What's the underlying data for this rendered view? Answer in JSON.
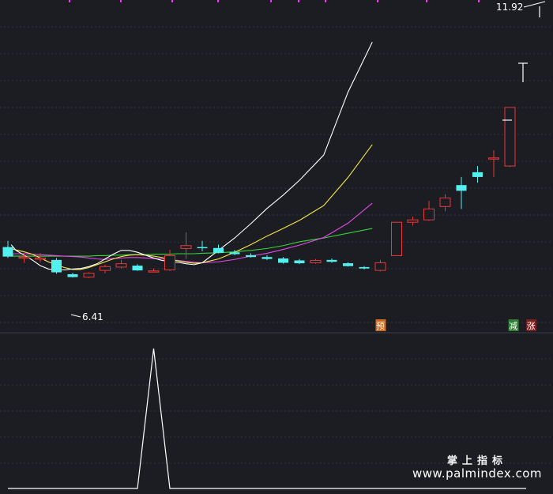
{
  "colors": {
    "background": "#1c1d22",
    "grid": "#2f3440",
    "up": "#e8383a",
    "down": "#54f0f0",
    "ma5": "#ffffff",
    "ma10": "#f5e84a",
    "ma20": "#e24be6",
    "ma60": "#38d23b",
    "indicator": "#ffffff",
    "signal_pre_bg": "#d2691e",
    "signal_reduce_bg": "#2e7d32",
    "signal_rise_bg": "#7a1f1f"
  },
  "chart_data": [
    {
      "type": "candlestick",
      "price_range": [
        5.6,
        12.2
      ],
      "high_label": "11.92",
      "low_label": "6.41",
      "candles": [
        {
          "o": 7.05,
          "h": 7.18,
          "l": 6.82,
          "c": 6.85
        },
        {
          "o": 6.83,
          "h": 6.9,
          "l": 6.72,
          "c": 6.84
        },
        {
          "o": 6.81,
          "h": 6.92,
          "l": 6.73,
          "c": 6.82
        },
        {
          "o": 6.78,
          "h": 6.82,
          "l": 6.49,
          "c": 6.52
        },
        {
          "o": 6.48,
          "h": 6.51,
          "l": 6.41,
          "c": 6.42
        },
        {
          "o": 6.42,
          "h": 6.52,
          "l": 6.4,
          "c": 6.5
        },
        {
          "o": 6.56,
          "h": 6.68,
          "l": 6.5,
          "c": 6.64
        },
        {
          "o": 6.63,
          "h": 6.78,
          "l": 6.6,
          "c": 6.7
        },
        {
          "o": 6.66,
          "h": 6.69,
          "l": 6.55,
          "c": 6.56
        },
        {
          "o": 6.55,
          "h": 6.6,
          "l": 6.52,
          "c": 6.55
        },
        {
          "o": 6.57,
          "h": 6.99,
          "l": 6.55,
          "c": 6.87
        },
        {
          "o": 7.02,
          "h": 7.36,
          "l": 6.8,
          "c": 7.08
        },
        {
          "o": 7.05,
          "h": 7.18,
          "l": 6.96,
          "c": 7.04
        },
        {
          "o": 7.03,
          "h": 7.1,
          "l": 6.92,
          "c": 6.93
        },
        {
          "o": 6.94,
          "h": 6.99,
          "l": 6.88,
          "c": 6.9
        },
        {
          "o": 6.88,
          "h": 6.92,
          "l": 6.83,
          "c": 6.84
        },
        {
          "o": 6.84,
          "h": 6.88,
          "l": 6.78,
          "c": 6.8
        },
        {
          "o": 6.81,
          "h": 6.84,
          "l": 6.7,
          "c": 6.72
        },
        {
          "o": 6.77,
          "h": 6.8,
          "l": 6.69,
          "c": 6.71
        },
        {
          "o": 6.72,
          "h": 6.8,
          "l": 6.7,
          "c": 6.77
        },
        {
          "o": 6.78,
          "h": 6.81,
          "l": 6.72,
          "c": 6.74
        },
        {
          "o": 6.71,
          "h": 6.73,
          "l": 6.64,
          "c": 6.65
        },
        {
          "o": 6.63,
          "h": 6.65,
          "l": 6.58,
          "c": 6.6
        },
        {
          "o": 6.56,
          "h": 6.78,
          "l": 6.54,
          "c": 6.72
        },
        {
          "o": 6.87,
          "h": 7.57,
          "l": 6.87,
          "c": 7.57
        },
        {
          "o": 7.57,
          "h": 7.69,
          "l": 7.5,
          "c": 7.62
        },
        {
          "o": 7.62,
          "h": 8.02,
          "l": 7.6,
          "c": 7.85
        },
        {
          "o": 7.9,
          "h": 8.16,
          "l": 7.8,
          "c": 8.08
        },
        {
          "o": 8.35,
          "h": 8.52,
          "l": 7.85,
          "c": 8.23
        },
        {
          "o": 8.62,
          "h": 8.75,
          "l": 8.4,
          "c": 8.52
        },
        {
          "o": 8.91,
          "h": 9.08,
          "l": 8.52,
          "c": 8.92
        },
        {
          "o": 8.75,
          "h": 9.98,
          "l": 8.73,
          "c": 9.98
        }
      ],
      "ma5": [
        7.1,
        6.98,
        6.88,
        6.78,
        6.66,
        6.59,
        6.57,
        6.57,
        6.59,
        6.6,
        6.64,
        6.7,
        6.8,
        6.9,
        6.98,
        6.98,
        6.94,
        6.88,
        6.82,
        6.77,
        6.75,
        6.73,
        6.7,
        6.68,
        6.72,
        6.98,
        7.24,
        7.54,
        7.86,
        8.14,
        8.45,
        8.98,
        10.3,
        11.35
      ],
      "ma10": [
        7.02,
        6.99,
        6.95,
        6.9,
        6.82,
        6.74,
        6.67,
        6.62,
        6.58,
        6.58,
        6.62,
        6.68,
        6.74,
        6.8,
        6.85,
        6.88,
        6.89,
        6.88,
        6.86,
        6.83,
        6.79,
        6.76,
        6.73,
        6.71,
        6.72,
        6.8,
        6.94,
        7.1,
        7.28,
        7.44,
        7.61,
        7.92,
        8.51,
        9.2
      ],
      "ma20": [
        6.9,
        6.91,
        6.91,
        6.9,
        6.89,
        6.88,
        6.87,
        6.86,
        6.85,
        6.84,
        6.82,
        6.8,
        6.79,
        6.81,
        6.82,
        6.83,
        6.83,
        6.82,
        6.81,
        6.8,
        6.78,
        6.77,
        6.75,
        6.73,
        6.72,
        6.74,
        6.79,
        6.86,
        6.92,
        7.0,
        7.09,
        7.25,
        7.55,
        7.97
      ],
      "ma60": [
        6.86,
        6.86,
        6.86,
        6.86,
        6.86,
        6.86,
        6.86,
        6.86,
        6.86,
        6.86,
        6.86,
        6.87,
        6.87,
        6.88,
        6.88,
        6.89,
        6.89,
        6.89,
        6.9,
        6.9,
        6.9,
        6.91,
        6.91,
        6.91,
        6.92,
        6.93,
        6.95,
        6.98,
        7.02,
        7.08,
        7.16,
        7.24,
        7.34,
        7.44
      ],
      "ma_positions": [
        0.2,
        0.5,
        1.0,
        1.5,
        2.0,
        2.5,
        3.0,
        3.5,
        4.0,
        4.5,
        5.0,
        5.5,
        6.0,
        6.5,
        7.0,
        7.5,
        8.0,
        8.5,
        9.0,
        9.5,
        10.0,
        10.5,
        11.0,
        11.5,
        12.0,
        13.0,
        14.0,
        15.0,
        16.0,
        17.0,
        18.0,
        19.5,
        21.0,
        22.5
      ],
      "signals": [
        {
          "text": "预",
          "index": 23
        },
        {
          "text": "减",
          "index": 31.2
        },
        {
          "text": "涨",
          "index": 32.3
        }
      ]
    },
    {
      "type": "line",
      "series": [
        {
          "values": [
            0,
            0,
            0,
            0,
            0,
            0,
            0,
            0,
            0,
            1,
            0,
            0,
            0,
            0,
            0,
            0,
            0,
            0,
            0,
            0,
            0,
            0,
            0,
            0,
            0,
            0,
            0,
            0,
            0,
            0,
            0,
            0,
            0
          ]
        }
      ],
      "ylim": [
        0,
        1
      ]
    }
  ],
  "watermark": {
    "line1": "掌上指标",
    "line2": "www.palmindex.com"
  }
}
